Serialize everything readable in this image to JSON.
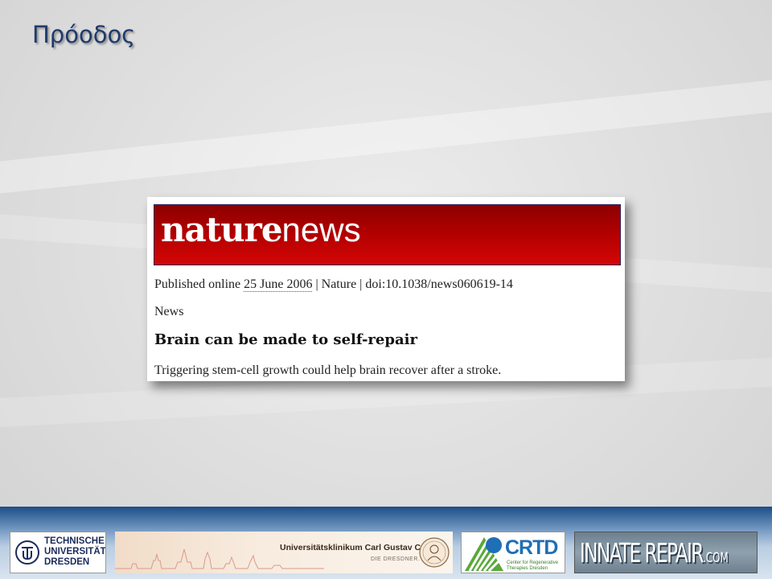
{
  "slide": {
    "title": "Πρόοδος"
  },
  "article": {
    "banner": {
      "brand_bold": "nature",
      "brand_light": "news"
    },
    "published_prefix": "Published online ",
    "published_date": "25 June 2006",
    "published_suffix": " | Nature | doi:10.1038/news060619-14",
    "section": "News",
    "headline": "Brain can be made to self-repair",
    "standfirst": "Triggering stem-cell growth could help brain recover after a stroke."
  },
  "footer": {
    "tu_dresden": {
      "line1": "TECHNISCHE",
      "line2": "UNIVERSITÄT",
      "line3": "DRESDEN"
    },
    "uniklinikum": {
      "name": "Universitätsklinikum Carl Gustav Carus",
      "tagline": "DIE DRESDNER."
    },
    "crtd": {
      "name": "CRTD",
      "sub1": "Center for Regenerative",
      "sub2": "Therapies Dresden"
    },
    "innate_repair": {
      "name": "INNATE REPAIR",
      "suffix": ".COM"
    }
  },
  "colors": {
    "banner_red": "#b00000",
    "title_blue": "#1f3a6b",
    "footer_blue": "#1c4e86",
    "crtd_blue": "#1e6fb5",
    "crtd_green": "#3a7f2a"
  }
}
